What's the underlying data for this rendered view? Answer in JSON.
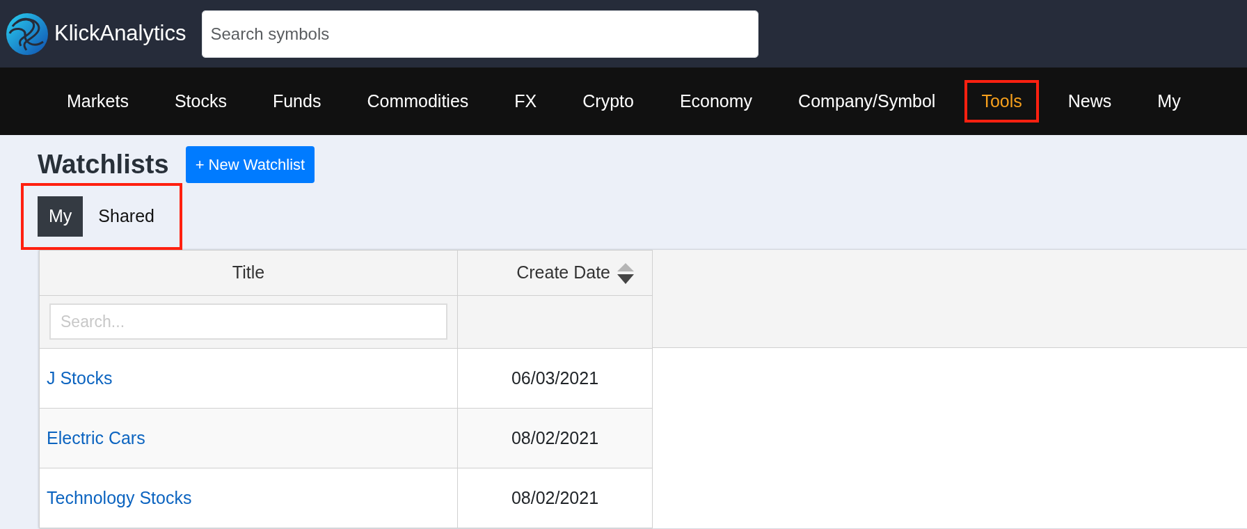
{
  "brand": {
    "name": "KlickAnalytics"
  },
  "search": {
    "placeholder": "Search symbols"
  },
  "nav": [
    {
      "label": "Markets",
      "selected": false,
      "highlighted": false
    },
    {
      "label": "Stocks",
      "selected": false,
      "highlighted": false
    },
    {
      "label": "Funds",
      "selected": false,
      "highlighted": false
    },
    {
      "label": "Commodities",
      "selected": false,
      "highlighted": false
    },
    {
      "label": "FX",
      "selected": false,
      "highlighted": false
    },
    {
      "label": "Crypto",
      "selected": false,
      "highlighted": false
    },
    {
      "label": "Economy",
      "selected": false,
      "highlighted": false
    },
    {
      "label": "Company/Symbol",
      "selected": false,
      "highlighted": false
    },
    {
      "label": "Tools",
      "selected": true,
      "highlighted": true
    },
    {
      "label": "News",
      "selected": false,
      "highlighted": false
    },
    {
      "label": "My",
      "selected": false,
      "highlighted": false
    }
  ],
  "page": {
    "title": "Watchlists",
    "new_button": "+ New Watchlist"
  },
  "tabs": {
    "highlighted": true,
    "items": [
      {
        "label": "My",
        "selected": true
      },
      {
        "label": "Shared",
        "selected": false
      }
    ]
  },
  "table": {
    "columns": [
      {
        "label": "Title",
        "sortable": false
      },
      {
        "label": "Create Date",
        "sortable": true
      }
    ],
    "filter": {
      "placeholder": "Search..."
    },
    "rows": [
      {
        "title": "J Stocks",
        "date": "06/03/2021"
      },
      {
        "title": "Electric Cars",
        "date": "08/02/2021"
      },
      {
        "title": "Technology Stocks",
        "date": "08/02/2021"
      }
    ]
  }
}
